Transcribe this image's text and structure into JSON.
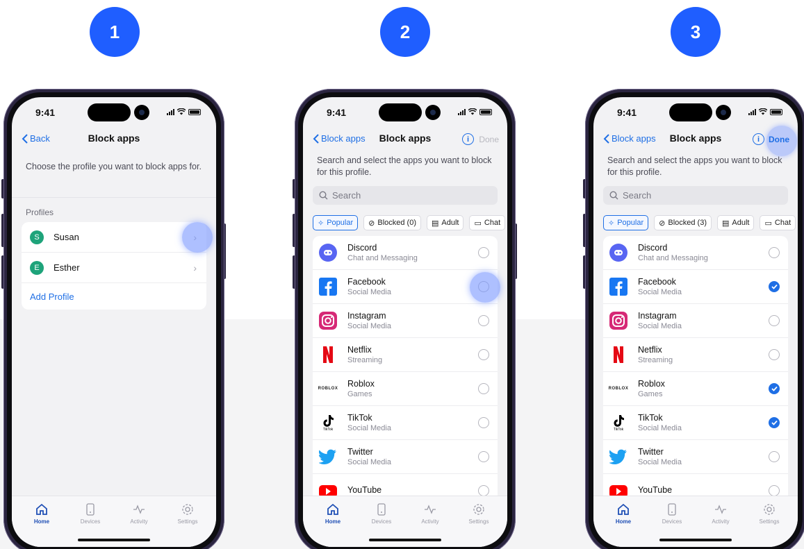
{
  "steps": [
    "1",
    "2",
    "3"
  ],
  "status": {
    "time": "9:41"
  },
  "screen1": {
    "back_label": "Back",
    "title": "Block apps",
    "intro": "Choose the profile you want to block apps for.",
    "section": "Profiles",
    "profiles": [
      {
        "initial": "S",
        "name": "Susan"
      },
      {
        "initial": "E",
        "name": "Esther"
      }
    ],
    "add_profile": "Add Profile"
  },
  "screen2": {
    "back_label": "Block apps",
    "title": "Block apps",
    "done_label": "Done",
    "intro": "Search and select the apps you want to block for this profile.",
    "search_placeholder": "Search",
    "chips": [
      "Popular",
      "Blocked (0)",
      "Adult",
      "Chat"
    ]
  },
  "screen3": {
    "back_label": "Block apps",
    "title": "Block apps",
    "done_label": "Done",
    "intro": "Search and select the apps you want to block for this profile.",
    "search_placeholder": "Search",
    "chips": [
      "Popular",
      "Blocked (3)",
      "Adult",
      "Chat"
    ]
  },
  "apps": [
    {
      "name": "Discord",
      "category": "Chat and Messaging",
      "icon": "discord-icon",
      "color": "#5865f2"
    },
    {
      "name": "Facebook",
      "category": "Social Media",
      "icon": "facebook-icon",
      "color": "#1877f2"
    },
    {
      "name": "Instagram",
      "category": "Social Media",
      "icon": "instagram-icon",
      "color": "#d62976"
    },
    {
      "name": "Netflix",
      "category": "Streaming",
      "icon": "netflix-icon",
      "color": "#e50914"
    },
    {
      "name": "Roblox",
      "category": "Games",
      "icon": "roblox-icon",
      "color": "#222222"
    },
    {
      "name": "TikTok",
      "category": "Social Media",
      "icon": "tiktok-icon",
      "color": "#000000"
    },
    {
      "name": "Twitter",
      "category": "Social Media",
      "icon": "twitter-icon",
      "color": "#1da1f2"
    },
    {
      "name": "YouTube",
      "category": "",
      "icon": "youtube-icon",
      "color": "#ff0000"
    }
  ],
  "screen3_selected": [
    false,
    true,
    false,
    false,
    true,
    true,
    false,
    false
  ],
  "tabbar": [
    "Home",
    "Devices",
    "Activity",
    "Settings"
  ],
  "roblox_wordmark": "ROBLOX",
  "tiktok_wordmark": "TikTok",
  "colors": {
    "accent": "#1f6fe5",
    "badge": "#1f5eff",
    "avatar": "#1ea37a"
  }
}
